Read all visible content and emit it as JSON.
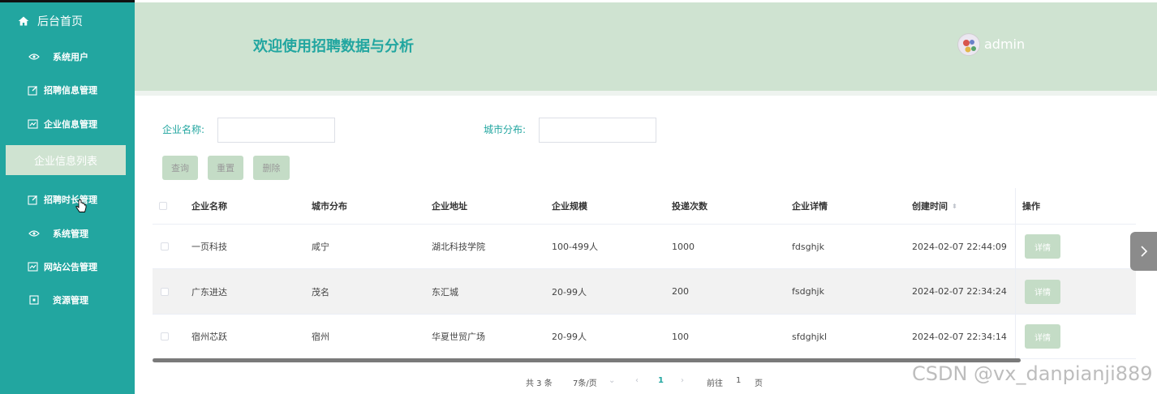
{
  "sidebar": {
    "home_label": "后台首页",
    "items": [
      {
        "label": "系统用户",
        "icon": "eye-icon"
      },
      {
        "label": "招聘信息管理",
        "icon": "edit-icon"
      },
      {
        "label": "企业信息管理",
        "icon": "chart-icon"
      },
      {
        "label": "招聘时长管理",
        "icon": "edit-icon"
      },
      {
        "label": "系统管理",
        "icon": "eye-icon"
      },
      {
        "label": "网站公告管理",
        "icon": "chart-icon"
      },
      {
        "label": "资源管理",
        "icon": "square-icon"
      }
    ],
    "active_sub_label": "企业信息列表"
  },
  "header": {
    "title": "欢迎使用招聘数据与分析",
    "username": "admin"
  },
  "search": {
    "company_label": "企业名称:",
    "company_value": "",
    "city_label": "城市分布:",
    "city_value": "",
    "query_label": "查询",
    "reset_label": "重置",
    "delete_label": "删除"
  },
  "table": {
    "columns": [
      "企业名称",
      "城市分布",
      "企业地址",
      "企业规模",
      "投递次数",
      "企业详情",
      "创建时间",
      "操作"
    ],
    "rows": [
      {
        "name": "一页科技",
        "city": "咸宁",
        "address": "湖北科技学院",
        "scale": "100-499人",
        "deliveries": "1000",
        "detail": "fdsghjk",
        "created": "2024-02-07 22:44:09",
        "action": "详情"
      },
      {
        "name": "广东进达",
        "city": "茂名",
        "address": "东汇城",
        "scale": "20-99人",
        "deliveries": "200",
        "detail": "fsdghjk",
        "created": "2024-02-07 22:34:24",
        "action": "详情"
      },
      {
        "name": "宿州芯跃",
        "city": "宿州",
        "address": "华夏世贸广场",
        "scale": "20-99人",
        "deliveries": "100",
        "detail": "sfdghjkl",
        "created": "2024-02-07 22:34:14",
        "action": "详情"
      }
    ]
  },
  "pagination": {
    "total": "共 3 条",
    "page_size": "7条/页",
    "current_page": "1",
    "goto_label": "前往",
    "goto_value": "1",
    "page_unit": "页"
  },
  "watermark": "CSDN @vx_danpianji889"
}
